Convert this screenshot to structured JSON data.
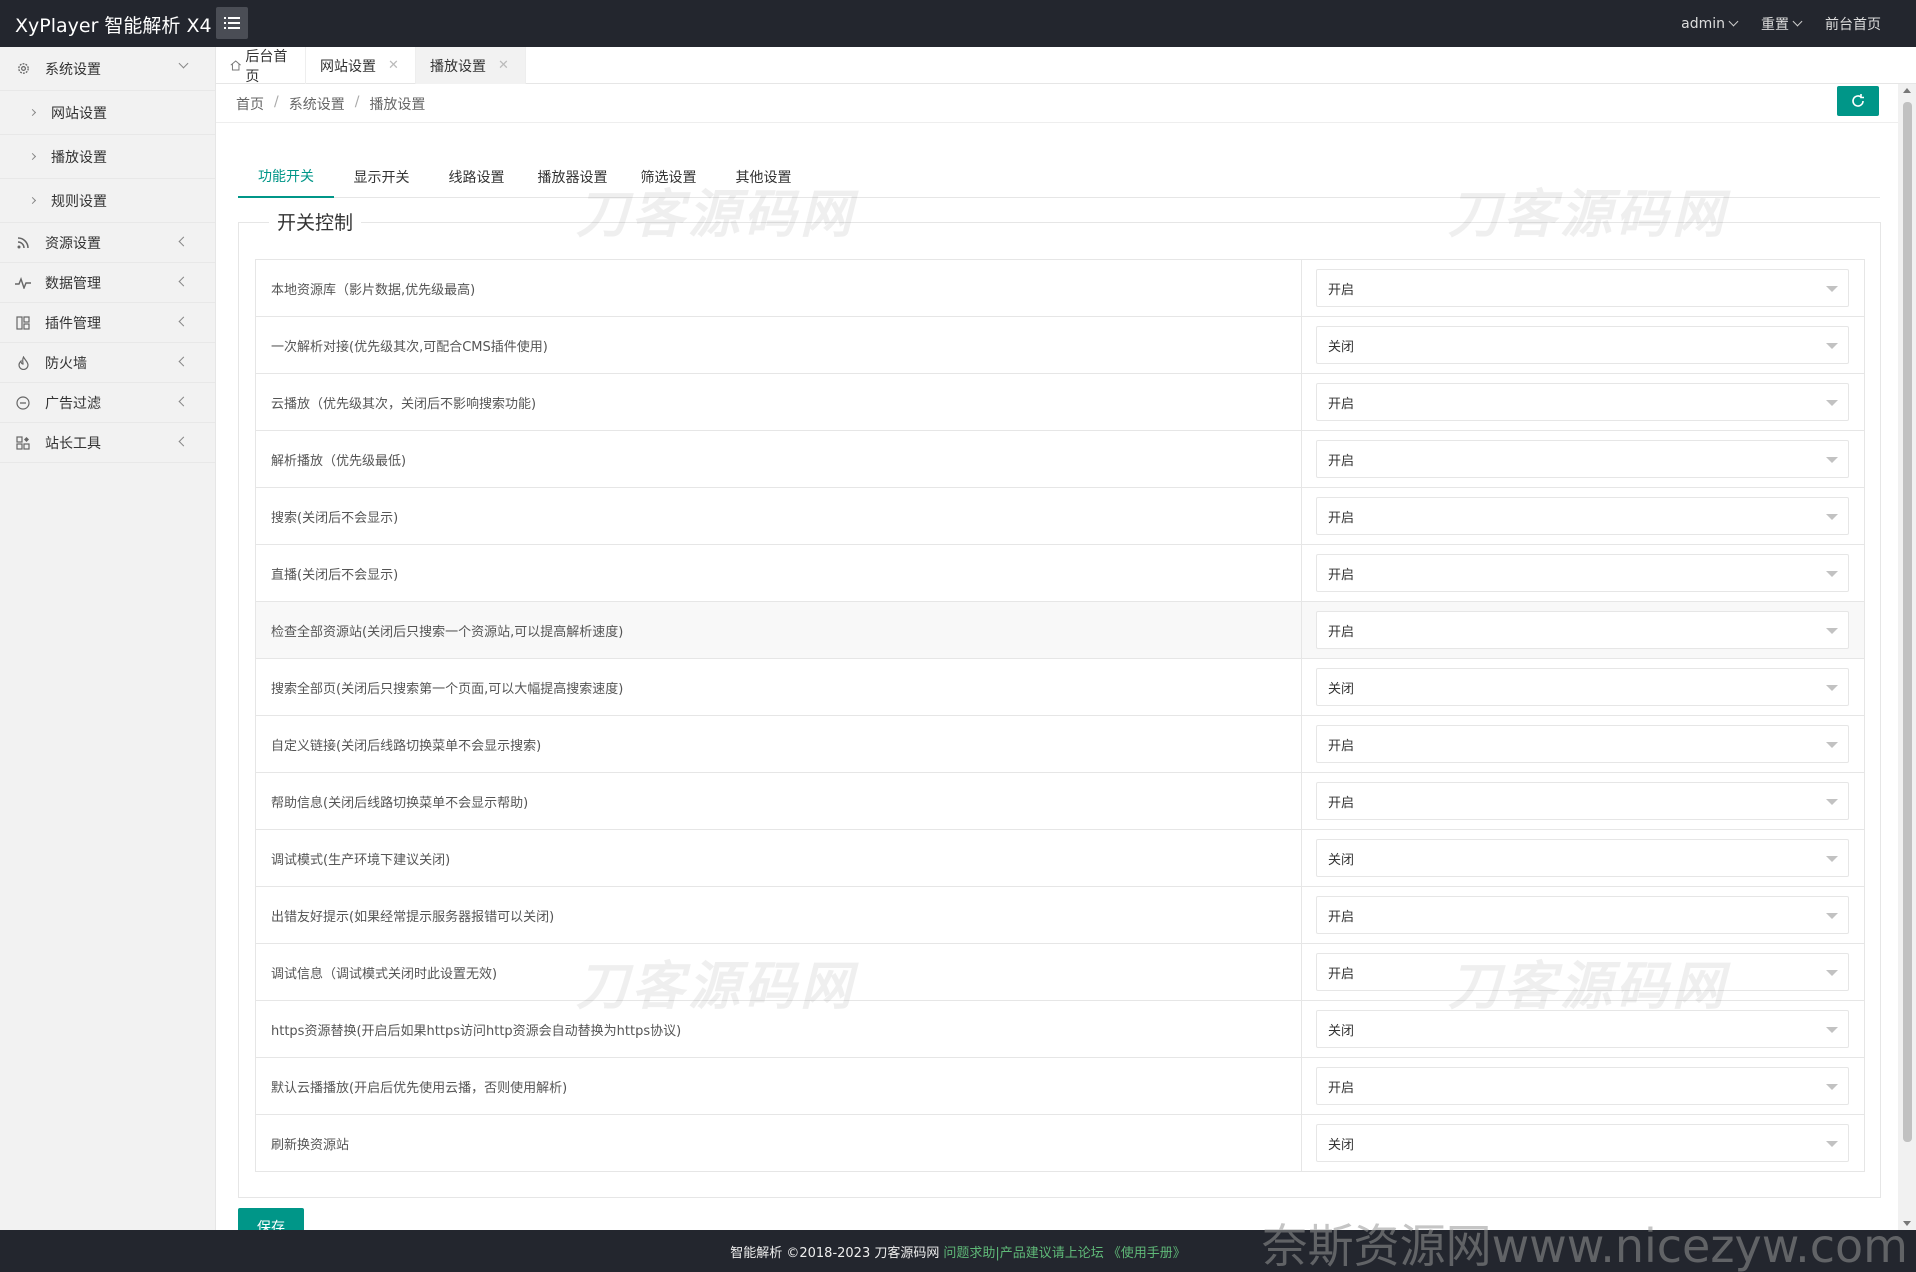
{
  "header": {
    "logo": "XyPlayer 智能解析 X4",
    "menu": [
      {
        "label": "admin",
        "has_dropdown": true
      },
      {
        "label": "重置",
        "has_dropdown": true
      },
      {
        "label": "前台首页",
        "has_dropdown": false
      }
    ]
  },
  "sidebar": {
    "groups": [
      {
        "label": "系统设置",
        "icon": "gear-icon",
        "expanded": true,
        "children": [
          {
            "label": "网站设置"
          },
          {
            "label": "播放设置"
          },
          {
            "label": "规则设置"
          }
        ]
      },
      {
        "label": "资源设置",
        "icon": "rss-icon"
      },
      {
        "label": "数据管理",
        "icon": "pulse-icon"
      },
      {
        "label": "插件管理",
        "icon": "plugin-icon"
      },
      {
        "label": "防火墙",
        "icon": "fire-icon"
      },
      {
        "label": "广告过滤",
        "icon": "minus-circle-icon"
      },
      {
        "label": "站长工具",
        "icon": "apps-icon"
      }
    ]
  },
  "tabs": [
    {
      "label": "后台首页",
      "icon": "home-icon",
      "closable": false
    },
    {
      "label": "网站设置",
      "closable": true
    },
    {
      "label": "播放设置",
      "closable": true,
      "active": true
    }
  ],
  "breadcrumb": [
    "首页",
    "系统设置",
    "播放设置"
  ],
  "subtabs": [
    "功能开关",
    "显示开关",
    "线路设置",
    "播放器设置",
    "筛选设置",
    "其他设置"
  ],
  "active_subtab": "功能开关",
  "fieldset": {
    "legend": "开关控制"
  },
  "settings": [
    {
      "label": "本地资源库（影片数据,优先级最高)",
      "value": "开启"
    },
    {
      "label": "一次解析对接(优先级其次,可配合CMS插件使用)",
      "value": "关闭"
    },
    {
      "label": "云播放（优先级其次，关闭后不影响搜索功能)",
      "value": "开启"
    },
    {
      "label": "解析播放（优先级最低)",
      "value": "开启"
    },
    {
      "label": "搜索(关闭后不会显示)",
      "value": "开启"
    },
    {
      "label": "直播(关闭后不会显示)",
      "value": "开启"
    },
    {
      "label": "检查全部资源站(关闭后只搜索一个资源站,可以提高解析速度)",
      "value": "开启"
    },
    {
      "label": "搜索全部页(关闭后只搜索第一个页面,可以大幅提高搜索速度)",
      "value": "关闭"
    },
    {
      "label": "自定义链接(关闭后线路切换菜单不会显示搜索)",
      "value": "开启"
    },
    {
      "label": "帮助信息(关闭后线路切换菜单不会显示帮助)",
      "value": "开启"
    },
    {
      "label": "调试模式(生产环境下建议关闭)",
      "value": "关闭"
    },
    {
      "label": "出错友好提示(如果经常提示服务器报错可以关闭)",
      "value": "开启"
    },
    {
      "label": "调试信息（调试模式关闭时此设置无效)",
      "value": "开启"
    },
    {
      "label": "https资源替换(开启后如果https访问http资源会自动替换为https协议)",
      "value": "关闭"
    },
    {
      "label": "默认云播播放(开启后优先使用云播，否则使用解析)",
      "value": "开启"
    },
    {
      "label": "刷新换资源站",
      "value": "关闭"
    }
  ],
  "save_label": "保存",
  "footer": {
    "copyright": "智能解析 ©2018-2023 刀客源码网",
    "link1": "问题求助|产品建议请上论坛",
    "link2": "《使用手册》"
  },
  "watermarks": [
    "刀客源码网",
    "刀客源码网",
    "刀客源码网",
    "刀客源码网"
  ],
  "corner_watermark": "奈斯资源网www.nicezyw.com",
  "colors": {
    "accent": "#009688",
    "header_bg": "#23262e",
    "footer_link": "#5fb878"
  }
}
